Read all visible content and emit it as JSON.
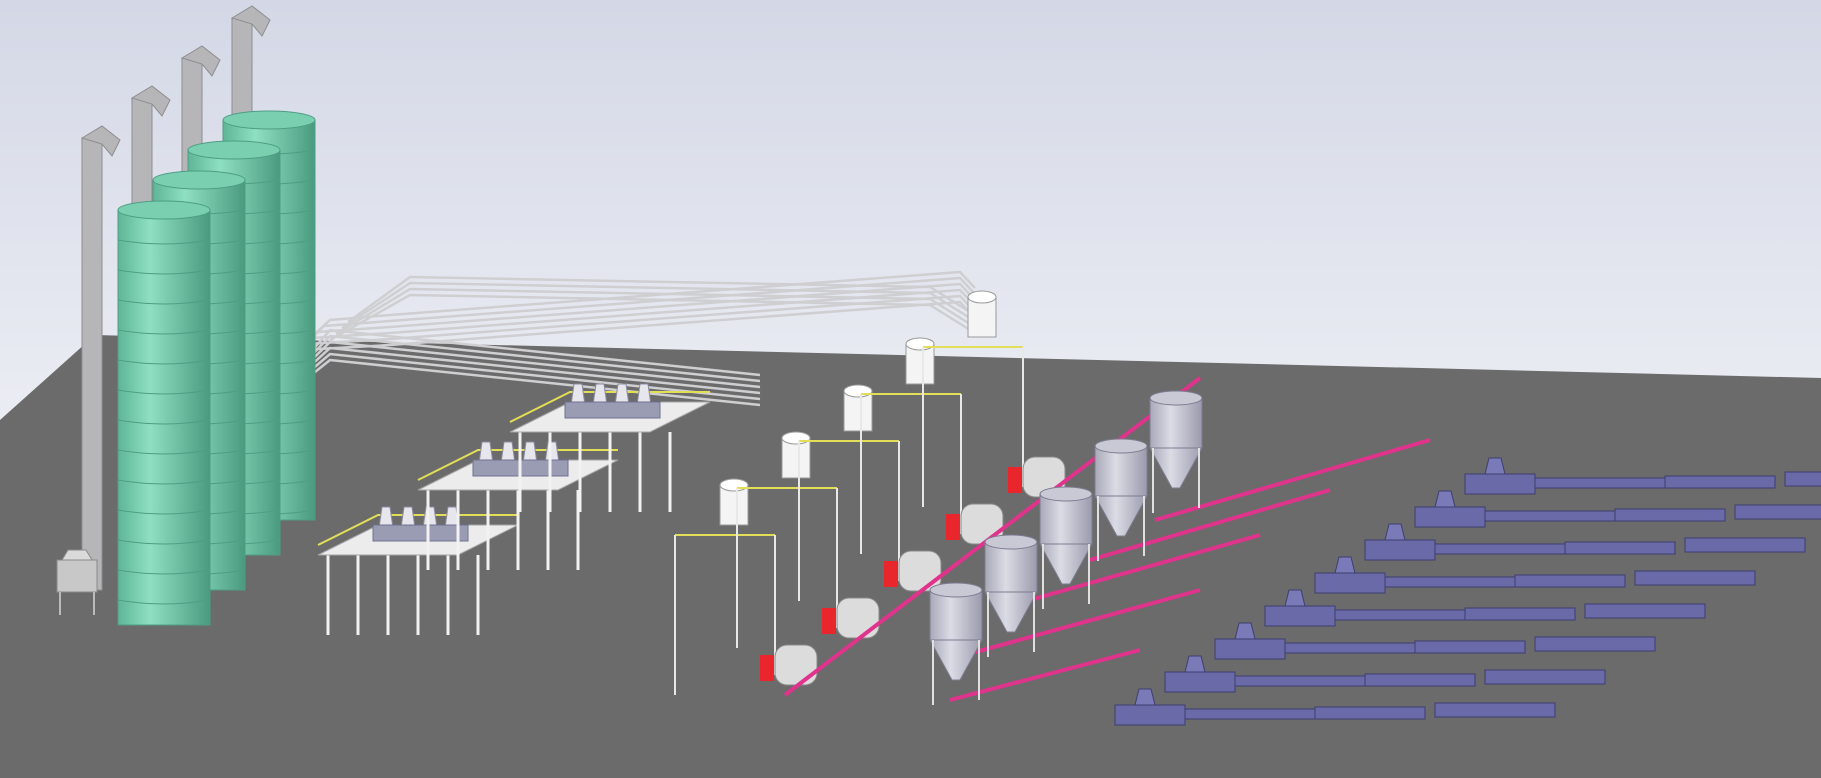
{
  "scene": {
    "view": "3d-cad-model",
    "subject": "plastics-extrusion-plant",
    "colors": {
      "sky_top": "#d4d8e6",
      "sky_bottom": "#ffffff",
      "floor": "#6b6b6b",
      "silo": "#79cfb0",
      "silo_shade": "#4e9e84",
      "elevator": "#b6b6b8",
      "platform": "#ececec",
      "railing": "#e3de58",
      "pipe": "#cfcfd2",
      "hopper": "#c9c9d6",
      "dryer_drum": "#dcdcdc",
      "motor_red": "#e8262c",
      "conveyor_pink": "#e0338c",
      "extruder": "#6a6aa8"
    },
    "counts": {
      "silos": 4,
      "bucket_elevators": 4,
      "mixing_platforms": 3,
      "dryer_stations": 5,
      "storage_hoppers": 5,
      "extrusion_lines": 8
    }
  }
}
